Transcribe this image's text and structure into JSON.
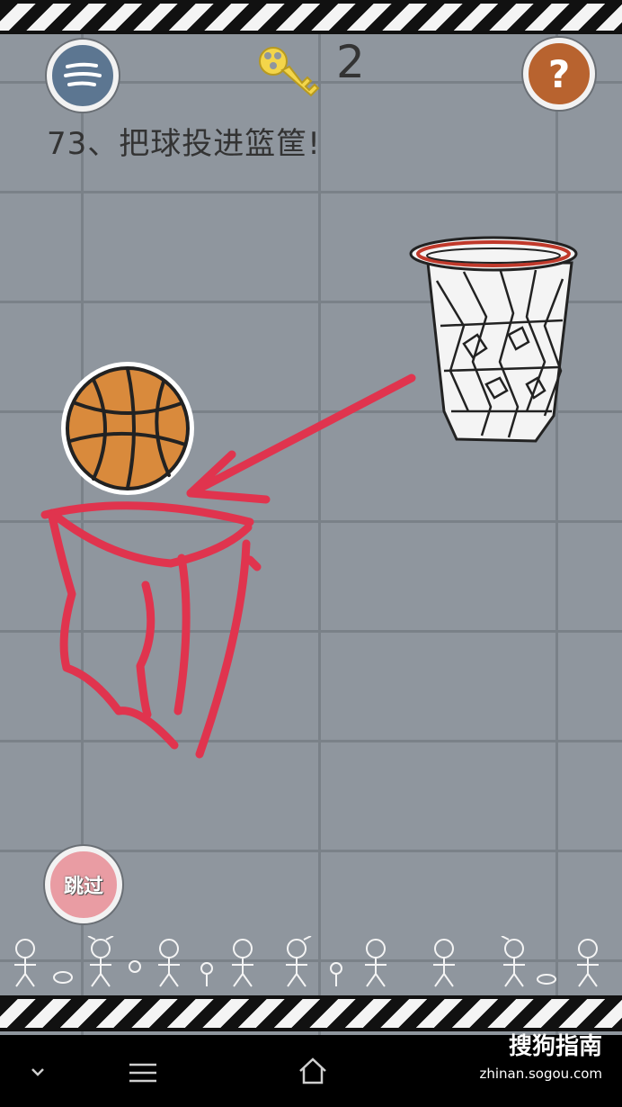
{
  "hud": {
    "key_count": "2",
    "level_title": "73、把球投进篮筐!",
    "skip_label": "跳过",
    "help_label": "?"
  },
  "icons": {
    "menu": "menu-icon",
    "key": "key-icon",
    "help": "question-icon",
    "basketball": "basketball-icon",
    "hoop": "basketball-hoop-icon",
    "back": "chevron-down-icon",
    "recents": "menu-lines-icon",
    "home": "home-icon"
  },
  "colors": {
    "wall": "#8f969e",
    "brick_line": "#7a8188",
    "menu_button": "#5c7691",
    "help_button": "#b8632f",
    "skip_button": "#e99ca3",
    "drawing": "#e0344e",
    "ball": "#d98a3c",
    "key": "#f3d54a"
  },
  "watermark": {
    "brand": "搜狗指南",
    "url": "zhinan.sogou.com"
  }
}
